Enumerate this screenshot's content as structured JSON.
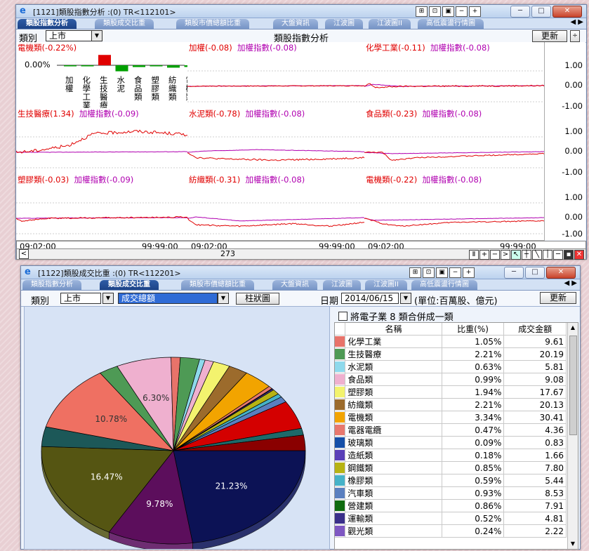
{
  "window1": {
    "title": "[1121]類股指數分析 :(0) TR<112101>",
    "tabs": [
      "類股指數分析",
      "類股成交比重",
      "類股市價總額比重",
      "大盤資訊",
      "江波圖",
      "江波圖II",
      "高低震盪行情圖"
    ],
    "category_label": "類別",
    "category_value": "上市",
    "center_title": "類股指數分析",
    "refresh_label": "更新",
    "bar_panel": {
      "label": "電機類(-0.22%)",
      "zero_label": "0.00%",
      "categories": [
        "加權",
        "化學工業",
        "生技醫療",
        "水泥",
        "食品類",
        "塑膠類",
        "紡織類",
        "電機類"
      ],
      "values": [
        -0.08,
        -0.11,
        1.34,
        -0.78,
        -0.23,
        -0.03,
        -0.31,
        -0.22
      ]
    },
    "panels": [
      {
        "name": "加權(-0.08)",
        "ref": "加權指數(-0.08)"
      },
      {
        "name": "化學工業(-0.11)",
        "ref": "加權指數(-0.08)"
      },
      {
        "name": "生技醫療(1.34)",
        "ref": "加權指數(-0.09)"
      },
      {
        "name": "水泥類(-0.78)",
        "ref": "加權指數(-0.08)"
      },
      {
        "name": "食品類(-0.23)",
        "ref": "加權指數(-0.08)"
      },
      {
        "name": "塑膠類(-0.03)",
        "ref": "加權指數(-0.09)"
      },
      {
        "name": "紡織類(-0.31)",
        "ref": "加權指數(-0.08)"
      },
      {
        "name": "電機類(-0.22)",
        "ref": "加權指數(-0.08)"
      }
    ],
    "scale_ticks": [
      "1.00",
      "0.00",
      "-1.00"
    ],
    "time_start": "09:02:00",
    "time_end": "99:99:00",
    "scroll_value": "273"
  },
  "window2": {
    "title": "[1122]類股成交比重 :(0) TR<112201>",
    "tabs": [
      "類股指數分析",
      "類股成交比重",
      "類股市價總額比重",
      "大盤資訊",
      "江波圖",
      "江波圖II",
      "高低震盪行情圖"
    ],
    "category_label": "類別",
    "category_value": "上市",
    "metric_value": "成交總額",
    "chart_type_button": "柱狀圖",
    "date_label": "日期",
    "date_value": "2014/06/15",
    "unit_text": "(單位:百萬股、億元)",
    "refresh_label": "更新",
    "merge_checkbox_label": "將電子業 8 類合併成一類",
    "table_headers": [
      "名稱",
      "比重(%)",
      "成交金額"
    ],
    "rows": [
      {
        "color": "#e8736a",
        "name": "化學工業",
        "pct": "1.05%",
        "amt": "9.61"
      },
      {
        "color": "#4e9a55",
        "name": "生技醫療",
        "pct": "2.21%",
        "amt": "20.19"
      },
      {
        "color": "#8ed9ec",
        "name": "水泥類",
        "pct": "0.63%",
        "amt": "5.81"
      },
      {
        "color": "#efb0cf",
        "name": "食品類",
        "pct": "0.99%",
        "amt": "9.08"
      },
      {
        "color": "#f3f36e",
        "name": "塑膠類",
        "pct": "1.94%",
        "amt": "17.67"
      },
      {
        "color": "#9c6b2c",
        "name": "紡織類",
        "pct": "2.21%",
        "amt": "20.13"
      },
      {
        "color": "#f2a400",
        "name": "電機類",
        "pct": "3.34%",
        "amt": "30.41"
      },
      {
        "color": "#e8786e",
        "name": "電器電纜",
        "pct": "0.47%",
        "amt": "4.36"
      },
      {
        "color": "#154fa8",
        "name": "玻璃類",
        "pct": "0.09%",
        "amt": "0.83"
      },
      {
        "color": "#5a3fb8",
        "name": "造紙類",
        "pct": "0.18%",
        "amt": "1.66"
      },
      {
        "color": "#b7b313",
        "name": "鋼鐵類",
        "pct": "0.85%",
        "amt": "7.80"
      },
      {
        "color": "#46b2c8",
        "name": "橡膠類",
        "pct": "0.59%",
        "amt": "5.44"
      },
      {
        "color": "#5a7fbf",
        "name": "汽車類",
        "pct": "0.93%",
        "amt": "8.53"
      },
      {
        "color": "#0f6b0f",
        "name": "營建類",
        "pct": "0.86%",
        "amt": "7.91"
      },
      {
        "color": "#3a2f8a",
        "name": "運輸類",
        "pct": "0.52%",
        "amt": "4.81"
      },
      {
        "color": "#7e57c2",
        "name": "觀光類",
        "pct": "0.24%",
        "amt": "2.22"
      }
    ],
    "pie_labels": [
      "6.30%",
      "10.78%",
      "16.47%",
      "9.78%",
      "21.23%"
    ]
  },
  "chart_data": {
    "type": "pie",
    "title": "",
    "slices": [
      {
        "label": "21.23%",
        "value": 21.23,
        "color": "#0c1255"
      },
      {
        "label": "9.78%",
        "value": 9.78,
        "color": "#5c0e5c"
      },
      {
        "label": "16.47%",
        "value": 16.47,
        "color": "#555512"
      },
      {
        "value": 3.2,
        "color": "#1c5858"
      },
      {
        "label": "10.78%",
        "value": 10.78,
        "color": "#ef7062"
      },
      {
        "value": 2.21,
        "color": "#4e9a55"
      },
      {
        "label": "6.30%",
        "value": 6.3,
        "color": "#efb0cf"
      },
      {
        "value": 1.05,
        "color": "#e8736a"
      },
      {
        "value": 2.21,
        "color": "#4e9a55"
      },
      {
        "value": 0.63,
        "color": "#8ed9ec"
      },
      {
        "value": 0.99,
        "color": "#efb0cf"
      },
      {
        "value": 1.94,
        "color": "#f3f36e"
      },
      {
        "value": 2.21,
        "color": "#9c6b2c"
      },
      {
        "value": 3.34,
        "color": "#f2a400"
      },
      {
        "value": 0.47,
        "color": "#e8786e"
      },
      {
        "value": 0.09,
        "color": "#154fa8"
      },
      {
        "value": 0.18,
        "color": "#5a3fb8"
      },
      {
        "value": 0.85,
        "color": "#b7b313"
      },
      {
        "value": 0.59,
        "color": "#46b2c8"
      },
      {
        "value": 0.93,
        "color": "#5a7fbf"
      },
      {
        "value": 4.6,
        "color": "#d40000"
      },
      {
        "value": 1.1,
        "color": "#1d6a6a"
      },
      {
        "value": 2.5,
        "color": "#8a0000"
      }
    ]
  }
}
